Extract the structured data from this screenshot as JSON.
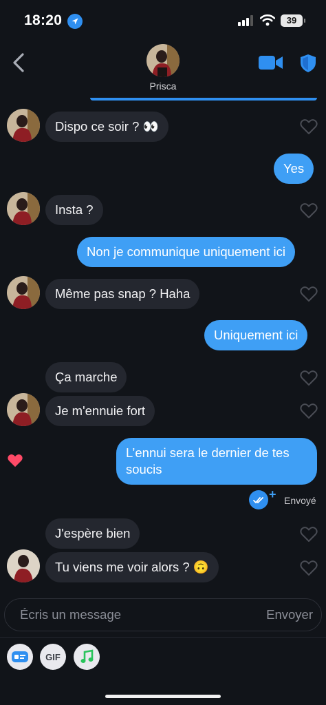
{
  "status_bar": {
    "time": "18:20",
    "battery": "39"
  },
  "header": {
    "contact_name": "Prisca"
  },
  "messages": {
    "m1": "Dispo ce soir ? 👀",
    "m2": "Yes",
    "m3": "Insta ?",
    "m4": "Non je communique uniquement ici",
    "m5": "Même pas snap ? Haha",
    "m6": "Uniquement ici",
    "m7": "Ça marche",
    "m8": "Je m'ennuie fort",
    "m9": "L’ennui sera le dernier de tes soucis",
    "m10": "J'espère bien",
    "m11": "Tu viens me voir alors ? 🙃"
  },
  "delivery": {
    "status_label": "Envoyé"
  },
  "composer": {
    "placeholder": "Écris un message",
    "send_label": "Envoyer"
  },
  "toolbar": {
    "gif_label": "GIF"
  },
  "icons": {
    "back": "chevron-left-icon",
    "video": "video-camera-icon",
    "shield": "shield-icon",
    "heart": "heart-outline-icon",
    "liked": "heart-filled-icon",
    "seen": "double-check-icon",
    "card": "contact-card-icon",
    "music": "music-note-icon"
  },
  "colors": {
    "accent": "#3f9ff5",
    "incoming_bubble": "#24272f",
    "background": "#111419",
    "like": "#ff4a67"
  }
}
